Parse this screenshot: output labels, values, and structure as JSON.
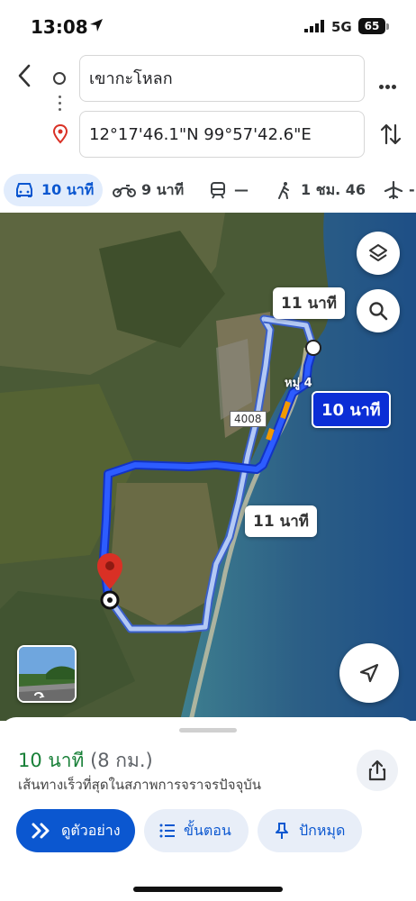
{
  "status_bar": {
    "time": "13:08",
    "network": "5G",
    "battery": "65"
  },
  "directions": {
    "origin": "เขากะโหลก",
    "destination": "12°17'46.1\"N 99°57'42.6\"E"
  },
  "modes": [
    {
      "icon": "car-icon",
      "label": "10 นาที",
      "active": true
    },
    {
      "icon": "motorcycle-icon",
      "label": "9 นาที"
    },
    {
      "icon": "transit-icon",
      "label": "—"
    },
    {
      "icon": "walk-icon",
      "label": "1 ชม. 46"
    },
    {
      "icon": "flight-icon",
      "label": "-"
    }
  ],
  "map": {
    "route_labels": {
      "alt_top": "11 นาที",
      "selected": "10 นาที",
      "alt_bottom": "11 นาที"
    },
    "road_number": "4008",
    "village_label": "หมู่ 4"
  },
  "sheet": {
    "duration": "10 นาที",
    "distance": "(8 กม.)",
    "description": "เส้นทางเร็วที่สุดในสภาพการจราจรปัจจุบัน",
    "buttons": {
      "preview": "ดูตัวอย่าง",
      "steps": "ขั้นตอน",
      "pin": "ปักหมุด"
    }
  },
  "colors": {
    "primary_route": "#1a47f5",
    "alt_route": "#a9c4f5",
    "accent": "#0b57d0",
    "duration_green": "#188038",
    "pin_red": "#d93025"
  }
}
